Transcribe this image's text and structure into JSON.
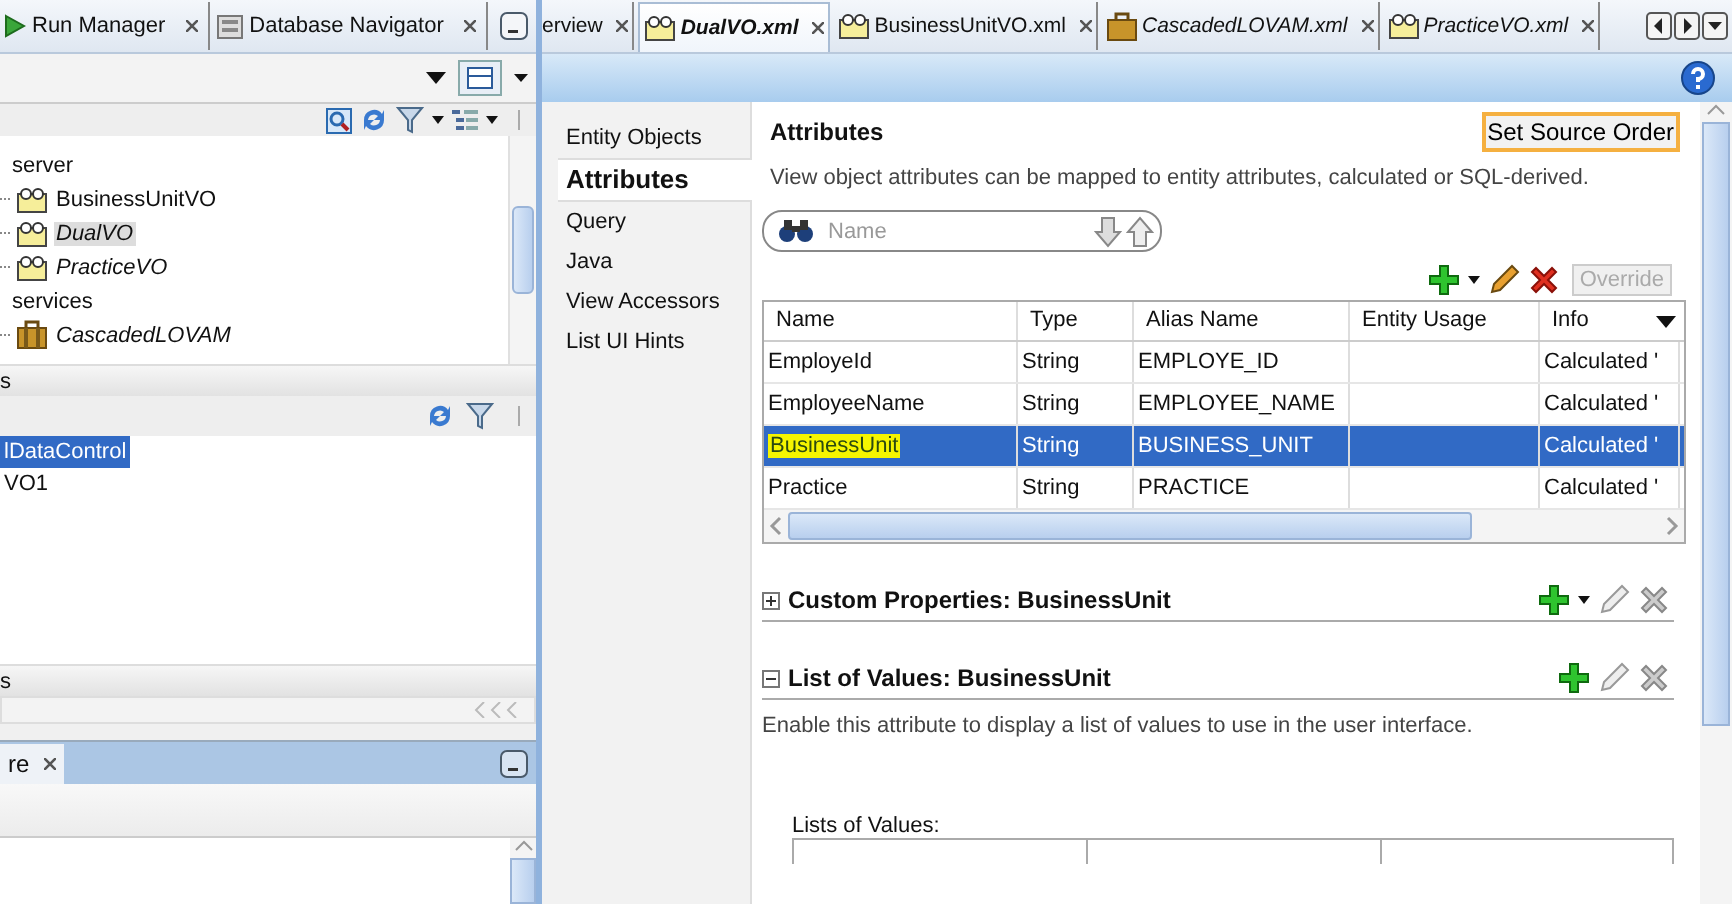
{
  "left_panel": {
    "tabs": [
      {
        "label": "Run Manager",
        "kind": "run",
        "selected": false
      },
      {
        "label": "Database Navigator",
        "kind": "database",
        "selected": false
      }
    ]
  },
  "tree": {
    "items": [
      {
        "label": "server",
        "modified": false,
        "selected": false,
        "children": [
          {
            "label": "BusinessUnitVO",
            "kind": "view-object",
            "modified": false,
            "selected": false
          },
          {
            "label": "DualVO",
            "kind": "view-object",
            "modified": true,
            "selected": true
          },
          {
            "label": "PracticeVO",
            "kind": "view-object",
            "modified": true,
            "selected": false
          }
        ]
      },
      {
        "label": "services",
        "modified": false,
        "selected": false,
        "children": [
          {
            "label": "CascadedLOVAM",
            "kind": "app-module",
            "modified": true,
            "selected": false
          }
        ]
      }
    ]
  },
  "section_header_1": {
    "label": "s"
  },
  "data_controls": {
    "items": [
      {
        "label": "lDataControl",
        "selected": true
      },
      {
        "label": "VO1",
        "selected": false
      }
    ]
  },
  "section_header_2": {
    "label": "s"
  },
  "bottom_panel": {
    "tabs": [
      {
        "label": "re",
        "selected": true
      }
    ]
  },
  "editor": {
    "tabs": [
      {
        "label": "erview",
        "kind": "overview",
        "modified": false,
        "selected": false
      },
      {
        "label": "DualVO.xml",
        "kind": "view-object",
        "modified": true,
        "selected": true
      },
      {
        "label": "BusinessUnitVO.xml",
        "kind": "view-object",
        "modified": false,
        "selected": false
      },
      {
        "label": "CascadedLOVAM.xml",
        "kind": "app-module",
        "modified": true,
        "selected": false
      },
      {
        "label": "PracticeVO.xml",
        "kind": "view-object",
        "modified": true,
        "selected": false
      }
    ],
    "nav": [
      {
        "label": "Entity Objects",
        "selected": false
      },
      {
        "label": "Attributes",
        "selected": true
      },
      {
        "label": "Query",
        "selected": false
      },
      {
        "label": "Java",
        "selected": false
      },
      {
        "label": "View Accessors",
        "selected": false
      },
      {
        "label": "List UI Hints",
        "selected": false
      }
    ],
    "title": "Attributes",
    "set_source_order": "Set Source Order",
    "description": "View object attributes can be mapped to entity attributes, calculated or SQL-derived.",
    "search": {
      "placeholder": "Name"
    },
    "override": {
      "label": "Override",
      "disabled": true
    },
    "table": {
      "columns": [
        "Name",
        "Type",
        "Alias Name",
        "Entity Usage",
        "Info"
      ],
      "rows": [
        {
          "cells": [
            "EmployeId",
            "String",
            "EMPLOYE_ID",
            "",
            "Calculated '"
          ],
          "selected": false,
          "highlighted": false
        },
        {
          "cells": [
            "EmployeeName",
            "String",
            "EMPLOYEE_NAME",
            "",
            "Calculated '"
          ],
          "selected": false,
          "highlighted": false
        },
        {
          "cells": [
            "BusinessUnit",
            "String",
            "BUSINESS_UNIT",
            "",
            "Calculated '"
          ],
          "selected": true,
          "highlighted": true
        },
        {
          "cells": [
            "Practice",
            "String",
            "PRACTICE",
            "",
            "Calculated '"
          ],
          "selected": false,
          "highlighted": false
        }
      ]
    },
    "sections": [
      {
        "title": "Custom Properties: BusinessUnit",
        "expanded": false,
        "add_menu": true
      },
      {
        "title": "List of Values: BusinessUnit",
        "expanded": true,
        "add_menu": false,
        "description": "Enable this attribute to display a list of values to use in the user interface.",
        "table_label": "Lists of Values:"
      }
    ]
  }
}
